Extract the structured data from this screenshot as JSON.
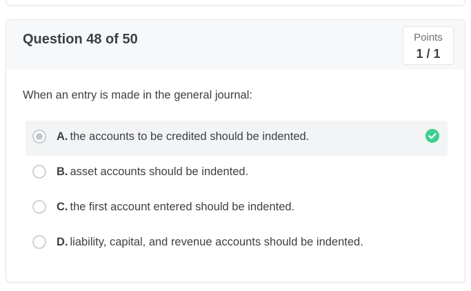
{
  "question": {
    "title": "Question 48 of 50",
    "points_label": "Points",
    "points_value": "1 / 1",
    "prompt": "When an entry is made in the general journal:"
  },
  "answers": [
    {
      "letter": "A.",
      "text": "the accounts to be credited should be indented.",
      "selected": true,
      "correct": true
    },
    {
      "letter": "B.",
      "text": "asset accounts should be indented.",
      "selected": false
    },
    {
      "letter": "C.",
      "text": "the first account entered should be indented.",
      "selected": false
    },
    {
      "letter": "D.",
      "text": "liability, capital, and revenue accounts should be indented.",
      "selected": false
    }
  ],
  "colors": {
    "correct": "#3ecf8e",
    "header_bg": "#f7f8f9",
    "selected_bg": "#f3f4f5"
  }
}
